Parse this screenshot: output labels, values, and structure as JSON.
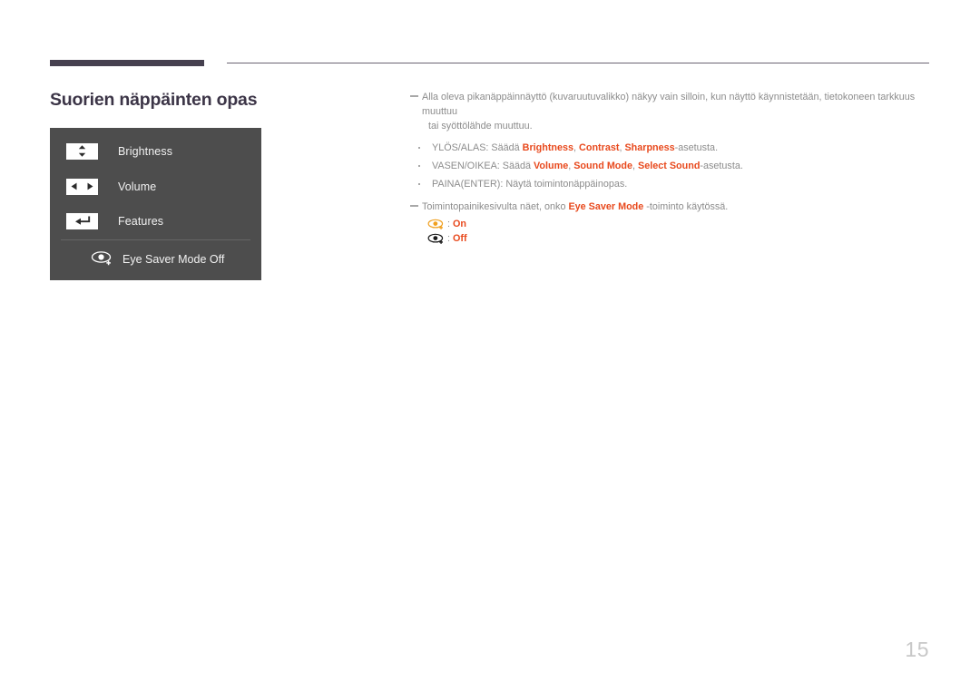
{
  "header": {
    "rule_accent_color": "#46404f",
    "rule_line_color": "#6b6572"
  },
  "page_title": "Suorien näppäinten opas",
  "osd_panel": {
    "background_color": "#4d4d4d",
    "rows": [
      {
        "icon": "up-down-arrows-icon",
        "label": "Brightness"
      },
      {
        "icon": "left-right-arrows-icon",
        "label": "Volume"
      },
      {
        "icon": "enter-return-arrow-icon",
        "label": "Features"
      }
    ],
    "eye_saver_row": {
      "icon": "eye-saver-off-icon",
      "label": "Eye Saver Mode Off"
    }
  },
  "notes": {
    "note1_line1": "Alla oleva pikanäppäinnäyttö (kuvaruutuvalikko) näkyy vain silloin, kun näyttö käynnistetään, tietokoneen tarkkuus muuttuu",
    "note1_line2": "tai syöttölähde muuttuu.",
    "bullets": [
      {
        "prefix": "YLÖS/ALAS: Säädä ",
        "terms": [
          "Brightness",
          "Contrast",
          "Sharpness"
        ],
        "suffix": "-asetusta."
      },
      {
        "prefix": "VASEN/OIKEA: Säädä ",
        "terms": [
          "Volume",
          "Sound Mode",
          "Select Sound"
        ],
        "suffix": "-asetusta."
      },
      {
        "prefix": "PAINA(ENTER): Näytä toimintonäppäinopas.",
        "terms": [],
        "suffix": ""
      }
    ],
    "note2_prefix": "Toimintopainikesivulta näet, onko ",
    "note2_term": "Eye Saver Mode",
    "note2_suffix": " -toiminto käytössä.",
    "legend": [
      {
        "icon": "eye-saver-on-icon",
        "separator": ":",
        "value": "On",
        "icon_color": "#f0a020"
      },
      {
        "icon": "eye-saver-off-icon",
        "separator": ":",
        "value": "Off",
        "icon_color": "#1a1a1a"
      }
    ],
    "highlight_color": "#e8491d",
    "body_color": "#8c8c8c"
  },
  "page_number": "15"
}
